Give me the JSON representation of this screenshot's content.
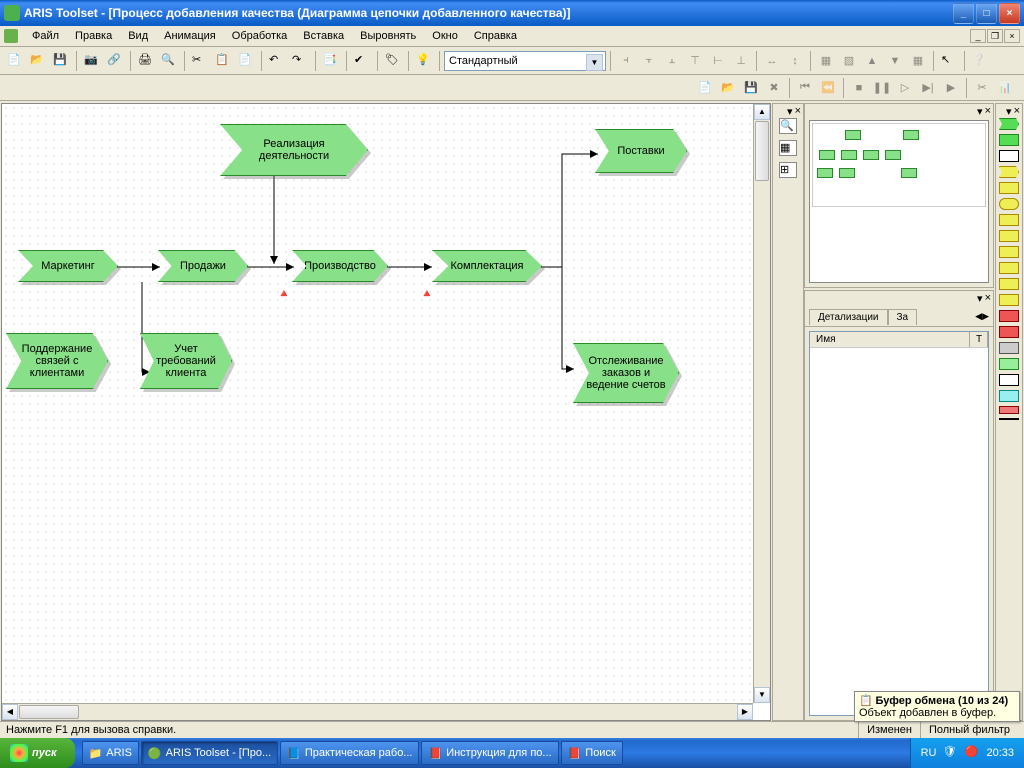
{
  "title": "ARIS Toolset - [Процесс добавления качества (Диаграмма цепочки добавленного качества)]",
  "menu": [
    "Файл",
    "Правка",
    "Вид",
    "Анимация",
    "Обработка",
    "Вставка",
    "Выровнять",
    "Окно",
    "Справка"
  ],
  "combo": {
    "value": "Стандартный"
  },
  "nodes": {
    "n1": "Реализация деятельности",
    "n2": "Поставки",
    "n3": "Маркетинг",
    "n4": "Продажи",
    "n5": "Производство",
    "n6": "Комплектация",
    "n7": "Поддержание связей с клиентами",
    "n8": "Учет требований клиента",
    "n9": "Отслеживание заказов и ведение счетов"
  },
  "tabs": {
    "t1": "Детализации",
    "t2": "За"
  },
  "props_col": {
    "c1": "Имя",
    "c2": "Т"
  },
  "clipboard": {
    "title": "Буфер обмена (10 из 24)",
    "text": "Объект добавлен в буфер."
  },
  "status": {
    "hint": "Нажмите F1 для вызова справки.",
    "changed": "Изменен",
    "filter": "Полный фильтр"
  },
  "taskbar": {
    "start": "пуск",
    "items": [
      "ARIS",
      "ARIS Toolset - [Про...",
      "Практическая рабо...",
      "Инструкция для по...",
      "Поиск"
    ],
    "lang": "RU",
    "clock": "20:33"
  }
}
